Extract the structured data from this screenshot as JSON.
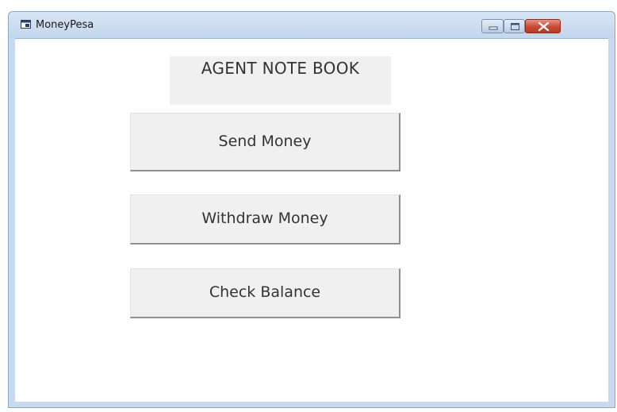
{
  "window": {
    "title": "MoneyPesa",
    "icon": "window-app-icon",
    "controls": {
      "minimize_icon": "minimize-icon",
      "maximize_icon": "maximize-icon",
      "close_icon": "close-icon"
    }
  },
  "form": {
    "heading": "AGENT NOTE BOOK",
    "buttons": {
      "send": "Send Money",
      "withdraw": "Withdraw Money",
      "balance": "Check Balance"
    }
  },
  "colors": {
    "titlebar": "#c8daee",
    "close_button": "#c94a32",
    "button_face": "#f0f0f0"
  }
}
